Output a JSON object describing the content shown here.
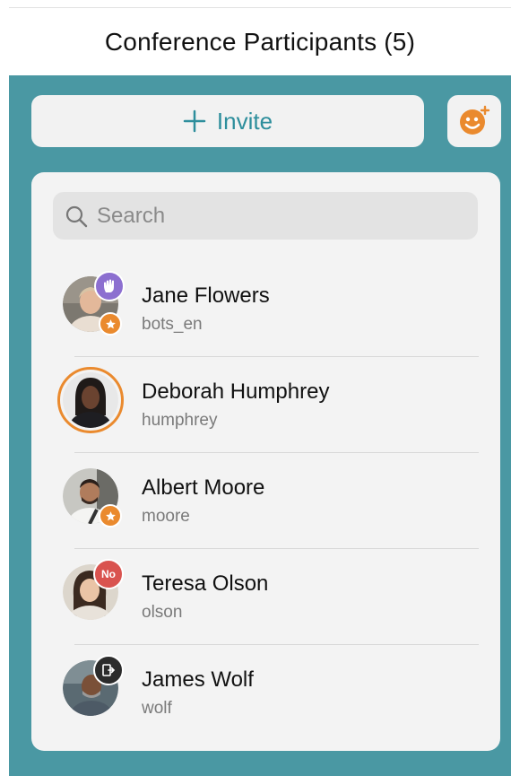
{
  "header": {
    "title": "Conference Participants (5)"
  },
  "invite": {
    "label": "Invite",
    "icon": "plus-icon"
  },
  "emoji_button": {
    "icon": "add-emoji-icon",
    "color": "#ea8a2e"
  },
  "search": {
    "placeholder": "Search",
    "value": ""
  },
  "colors": {
    "background": "#4a98a3",
    "accent": "#2d8e9c",
    "speaking_ring": "#ea8a2e",
    "raise_hand_badge": "#8c6fd0",
    "muted_badge": "#d9534f",
    "host_badge": "#ea8a2e"
  },
  "participants": [
    {
      "name": "Jane Flowers",
      "username": "bots_en",
      "badge": "raise-hand-icon",
      "role": "star-icon"
    },
    {
      "name": "Deborah Humphrey",
      "username": "humphrey",
      "badge": "speaking-ring"
    },
    {
      "name": "Albert Moore",
      "username": "moore",
      "role": "star-icon"
    },
    {
      "name": "Teresa Olson",
      "username": "olson",
      "badge": "No"
    },
    {
      "name": "James Wolf",
      "username": "wolf",
      "badge": "leave-icon"
    }
  ]
}
